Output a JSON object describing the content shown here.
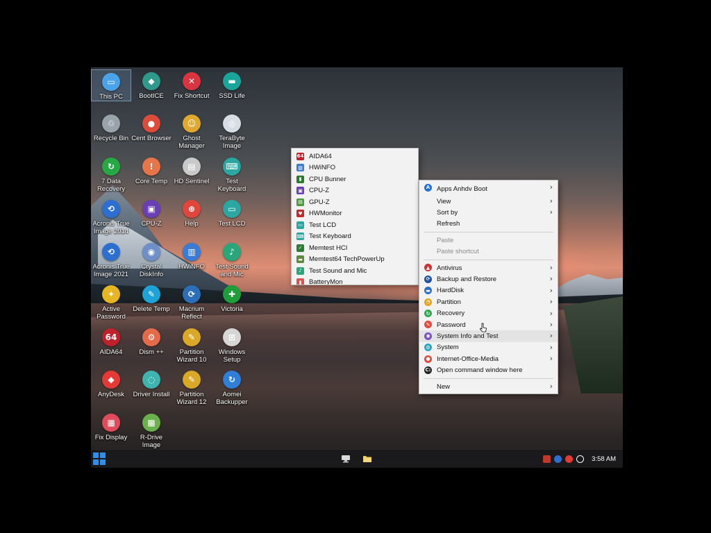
{
  "desktop": {
    "icons": [
      {
        "label": "This PC",
        "glyph": "▭",
        "color": "#4aa3e8",
        "icon": "computer-icon",
        "selected": true
      },
      {
        "label": "BootICE",
        "glyph": "◆",
        "color": "#2e9a8c",
        "icon": "bootice-icon"
      },
      {
        "label": "Fix Shortcut",
        "glyph": "✕",
        "color": "#d9343f",
        "icon": "fix-shortcut-icon"
      },
      {
        "label": "SSD Life",
        "glyph": "▬",
        "color": "#1aa59a",
        "icon": "ssd-life-icon"
      },
      {
        "label": "Recycle Bin",
        "glyph": "♲",
        "color": "#9aa3ab",
        "icon": "recycle-bin-icon"
      },
      {
        "label": "Cent Browser",
        "glyph": "●",
        "color": "#dd4b39",
        "icon": "cent-browser-icon"
      },
      {
        "label": "Ghost Manager",
        "glyph": "☺",
        "color": "#e0a82e",
        "icon": "ghost-manager-icon"
      },
      {
        "label": "TeraByte Image",
        "glyph": "◎",
        "color": "#d6dde4",
        "icon": "terabyte-image-icon"
      },
      {
        "label": "7 Data Recovery",
        "glyph": "↻",
        "color": "#27a844",
        "icon": "data-recovery-icon"
      },
      {
        "label": "Core Temp",
        "glyph": "!",
        "color": "#e8744a",
        "icon": "core-temp-icon"
      },
      {
        "label": "HD Sentinel",
        "glyph": "▤",
        "color": "#c9c9c9",
        "icon": "hd-sentinel-icon"
      },
      {
        "label": "Test Keyboard",
        "glyph": "⌨",
        "color": "#2aa7a0",
        "icon": "keyboard-icon"
      },
      {
        "label": "Acronis True Image 2014",
        "glyph": "⟲",
        "color": "#2c6fd1",
        "icon": "acronis-icon"
      },
      {
        "label": "CPU-Z",
        "glyph": "▣",
        "color": "#6a3fb5",
        "icon": "cpu-z-icon"
      },
      {
        "label": "Help",
        "glyph": "⊕",
        "color": "#e0463c",
        "icon": "help-icon"
      },
      {
        "label": "Test LCD",
        "glyph": "▭",
        "color": "#2aa7a0",
        "icon": "lcd-icon"
      },
      {
        "label": "Acronis True Image 2021",
        "glyph": "⟲",
        "color": "#2c6fd1",
        "icon": "acronis-icon"
      },
      {
        "label": "Crystal DiskInfo",
        "glyph": "◉",
        "color": "#6f8fc9",
        "icon": "crystal-diskinfo-icon"
      },
      {
        "label": "HWiNFO",
        "glyph": "▥",
        "color": "#3a7bd5",
        "icon": "hwinfo-icon"
      },
      {
        "label": "Test Sound and Mic",
        "glyph": "♪",
        "color": "#2aa77a",
        "icon": "sound-icon"
      },
      {
        "label": "Active Password",
        "glyph": "✦",
        "color": "#e5b522",
        "icon": "active-password-icon"
      },
      {
        "label": "Delete Temp",
        "glyph": "✎",
        "color": "#1ea3d6",
        "icon": "delete-temp-icon"
      },
      {
        "label": "Macrium Reflect",
        "glyph": "⟳",
        "color": "#2a6fb8",
        "icon": "macrium-icon"
      },
      {
        "label": "Victoria",
        "glyph": "✚",
        "color": "#1f9d3a",
        "icon": "victoria-icon"
      },
      {
        "label": "AIDA64",
        "glyph": "64",
        "color": "#c0202a",
        "icon": "aida64-icon"
      },
      {
        "label": "Dism ++",
        "glyph": "⚙",
        "color": "#e46a4a",
        "icon": "dism-icon"
      },
      {
        "label": "Partition Wizard 10",
        "glyph": "✎",
        "color": "#d9a826",
        "icon": "partition-wizard-icon"
      },
      {
        "label": "Windows Setup",
        "glyph": "⊞",
        "color": "#d6d6d6",
        "icon": "windows-setup-icon"
      },
      {
        "label": "AnyDesk",
        "glyph": "◆",
        "color": "#e53935",
        "icon": "anydesk-icon"
      },
      {
        "label": "Driver Install",
        "glyph": "◌",
        "color": "#3fb3b0",
        "icon": "driver-install-icon"
      },
      {
        "label": "Partition Wizard 12",
        "glyph": "✎",
        "color": "#d9a826",
        "icon": "partition-wizard-icon"
      },
      {
        "label": "Aomei Backupper",
        "glyph": "↻",
        "color": "#2f7ed8",
        "icon": "aomei-icon"
      },
      {
        "label": "Fix Display",
        "glyph": "▦",
        "color": "#e04c5c",
        "icon": "fix-display-icon"
      },
      {
        "label": "R-Drive Image",
        "glyph": "▩",
        "color": "#6ab04c",
        "icon": "r-drive-icon"
      }
    ]
  },
  "submenu": {
    "items": [
      {
        "label": "AIDA64",
        "glyph": "64",
        "color": "#c0202a",
        "icon": "aida64-icon"
      },
      {
        "label": "HWiNFO",
        "glyph": "▥",
        "color": "#3a7bd5",
        "icon": "hwinfo-icon"
      },
      {
        "label": "CPU Bunner",
        "glyph": "▮",
        "color": "#2c7a2c",
        "icon": "cpu-burner-icon"
      },
      {
        "label": "CPU-Z",
        "glyph": "▣",
        "color": "#6a3fb5",
        "icon": "cpu-z-icon"
      },
      {
        "label": "GPU-Z",
        "glyph": "▤",
        "color": "#4a9a3a",
        "icon": "gpu-z-icon"
      },
      {
        "label": "HWMonitor",
        "glyph": "♥",
        "color": "#c62828",
        "icon": "hwmonitor-icon"
      },
      {
        "label": "Test LCD",
        "glyph": "▭",
        "color": "#2aa7a0",
        "icon": "lcd-icon"
      },
      {
        "label": "Test Keyboard",
        "glyph": "⌨",
        "color": "#2aa7a0",
        "icon": "keyboard-icon"
      },
      {
        "label": "Memtest HCI",
        "glyph": "✓",
        "color": "#2e7d32",
        "icon": "memtest-icon"
      },
      {
        "label": "Memtest64 TechPowerUp",
        "glyph": "▬",
        "color": "#5a8a3a",
        "icon": "memtest64-icon"
      },
      {
        "label": "Test Sound and Mic",
        "glyph": "♪",
        "color": "#2aa77a",
        "icon": "sound-icon"
      },
      {
        "label": "BatteryMon",
        "glyph": "▮",
        "color": "#d9534f",
        "icon": "batterymon-icon"
      }
    ]
  },
  "context_menu": {
    "group1": [
      {
        "label": "Apps Anhdv Boot",
        "glyph": "A",
        "color": "#1e6fd9",
        "icon": "apps-anhdv-icon",
        "submenu": true
      },
      {
        "label": "View",
        "submenu": true
      },
      {
        "label": "Sort by",
        "submenu": true
      },
      {
        "label": "Refresh",
        "submenu": false
      }
    ],
    "group2": [
      {
        "label": "Paste",
        "disabled": true
      },
      {
        "label": "Paste shortcut",
        "disabled": true
      }
    ],
    "group3": [
      {
        "label": "Antivirus",
        "glyph": "▲",
        "color": "#d32f2f",
        "icon": "antivirus-icon",
        "submenu": true
      },
      {
        "label": "Backup and Restore",
        "glyph": "⟳",
        "color": "#1e4fa8",
        "icon": "backup-restore-icon",
        "submenu": true
      },
      {
        "label": "HardDisk",
        "glyph": "▬",
        "color": "#2a6fc9",
        "icon": "harddisk-icon",
        "submenu": true
      },
      {
        "label": "Partition",
        "glyph": "◔",
        "color": "#e8a317",
        "icon": "partition-icon",
        "submenu": true
      },
      {
        "label": "Recovery",
        "glyph": "↻",
        "color": "#2fa84f",
        "icon": "recovery-icon",
        "submenu": true
      },
      {
        "label": "Password",
        "glyph": "✎",
        "color": "#e64a3c",
        "icon": "password-icon",
        "submenu": true
      },
      {
        "label": "System Info and Test",
        "glyph": "◉",
        "color": "#7b4fc4",
        "icon": "system-info-icon",
        "submenu": true,
        "hover": true
      },
      {
        "label": "System",
        "glyph": "⚙",
        "color": "#26a8c6",
        "icon": "system-icon",
        "submenu": true
      },
      {
        "label": "Internet-Office-Media",
        "glyph": "●",
        "color": "#dd4b39",
        "icon": "internet-icon",
        "submenu": true
      },
      {
        "label": "Open command window here",
        "glyph": "C:",
        "color": "#222222",
        "icon": "command-prompt-icon",
        "submenu": false
      }
    ],
    "group4": [
      {
        "label": "New",
        "submenu": true
      }
    ]
  },
  "taskbar": {
    "clock": "3:58 AM",
    "pinned": [
      "network-icon",
      "folder-icon"
    ],
    "tray": [
      {
        "icon": "network-status-icon",
        "color": "#c0392b"
      },
      {
        "icon": "anhdv-icon",
        "color": "#2c6fd1"
      },
      {
        "icon": "media-icon",
        "color": "#e53935"
      },
      {
        "icon": "volume-icon",
        "color": "#ffffff"
      }
    ]
  }
}
